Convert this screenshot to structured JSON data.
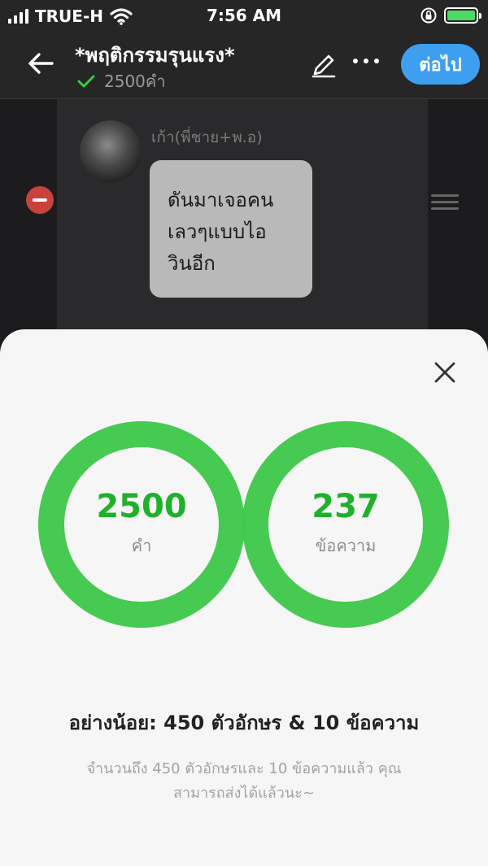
{
  "status_bar": {
    "carrier": "TRUE-H",
    "time": "7:56 AM",
    "battery_color": "#4cd964"
  },
  "header": {
    "title": "*พฤติกรรมรุนแรง*",
    "word_count": "2500คำ",
    "next_label": "ต่อไป",
    "icons": [
      "back-arrow-icon",
      "check-icon",
      "pencil-icon",
      "more-icon"
    ]
  },
  "chat": {
    "sender": "เก้า(พี่ชาย+พ.อ)",
    "message_lines": [
      "ดันมาเจอคน",
      "เลวๆแบบไอ",
      "วินอีก"
    ]
  },
  "stats_sheet": {
    "words_value": "2500",
    "words_unit": "คำ",
    "messages_value": "237",
    "messages_unit": "ข้อความ",
    "requirement": "อย่างน้อย: 450 ตัวอักษร & 10 ข้อความ",
    "hint_line1": "จำนวนถึง 450 ตัวอักษรและ 10 ข้อความแล้ว คุณ",
    "hint_line2": "สามารถส่งได้แล้วนะ~",
    "ring_color": "#40c84a",
    "accent_green": "#1fb12a"
  },
  "colors": {
    "primary_blue": "#3e9ef0",
    "delete_red": "#c9423c"
  }
}
